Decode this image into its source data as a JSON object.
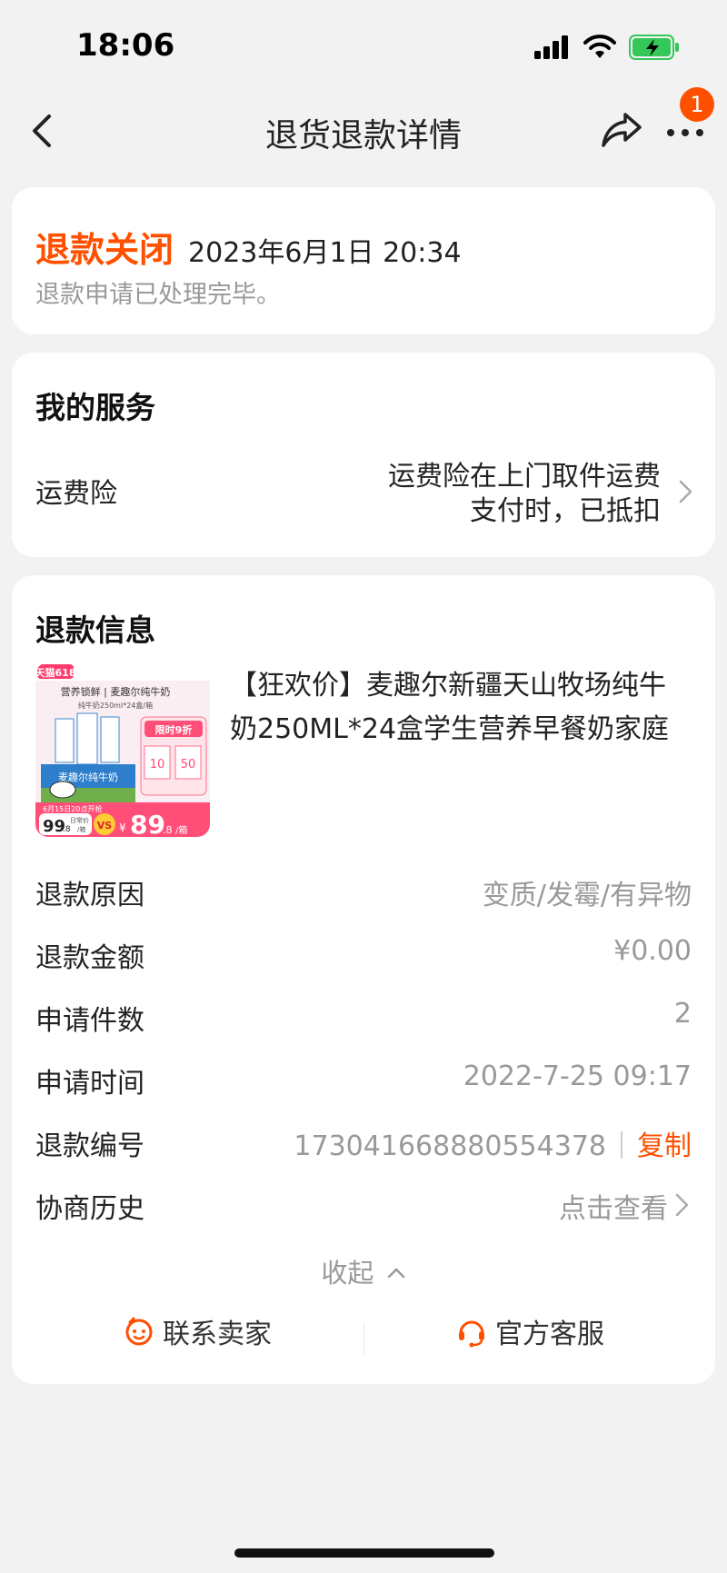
{
  "status_bar": {
    "time": "18:06",
    "icons": [
      "signal-icon",
      "wifi-icon",
      "battery-charging-icon"
    ],
    "battery_color": "#34c759"
  },
  "nav": {
    "title": "退货退款详情",
    "badge_count": "1",
    "icons": [
      "back-icon",
      "share-icon",
      "more-icon"
    ]
  },
  "status_card": {
    "title": "退款关闭",
    "datetime": "2023年6月1日 20:34",
    "description": "退款申请已处理完毕。"
  },
  "service_card": {
    "heading": "我的服务",
    "label": "运费险",
    "value_line1": "运费险在上门取件运费",
    "value_line2": "支付时，已抵扣"
  },
  "refund_card": {
    "heading": "退款信息",
    "product": {
      "title": "【狂欢价】麦趣尔新疆天山牧场纯牛奶250ML*24盒学生营养早餐奶家庭",
      "image_texts": {
        "tag": "天猫618",
        "headline": "营养锁鲜 | 麦趣尔纯牛奶",
        "sub": "纯牛奶250ml*24盒/箱",
        "promo": "限时9折",
        "coupon1": "10",
        "coupon2": "50",
        "brand_box": "麦趣尔纯牛奶",
        "date": "6月15日20点开抢",
        "old_price": "99",
        "old_price_dec": ".8",
        "old_unit": "/箱",
        "old_label": "日常价",
        "vs": "VS",
        "currency": "¥",
        "new_price": "89",
        "new_price_dec": ".8",
        "new_unit": "/箱"
      }
    },
    "rows": [
      {
        "label": "退款原因",
        "value": "变质/发霉/有异物"
      },
      {
        "label": "退款金额",
        "value": "¥0.00"
      },
      {
        "label": "申请件数",
        "value": "2"
      },
      {
        "label": "申请时间",
        "value": "2022-7-25 09:17"
      },
      {
        "label": "退款编号",
        "value": "1730416688805543​78",
        "action": "复制"
      },
      {
        "label": "协商历史",
        "value": "点击查看"
      }
    ],
    "collapse_label": "收起",
    "contact_seller": "联系卖家",
    "official_service": "官方客服"
  },
  "colors": {
    "accent": "#ff5000",
    "muted": "#999999",
    "background": "#f2f2f2"
  }
}
